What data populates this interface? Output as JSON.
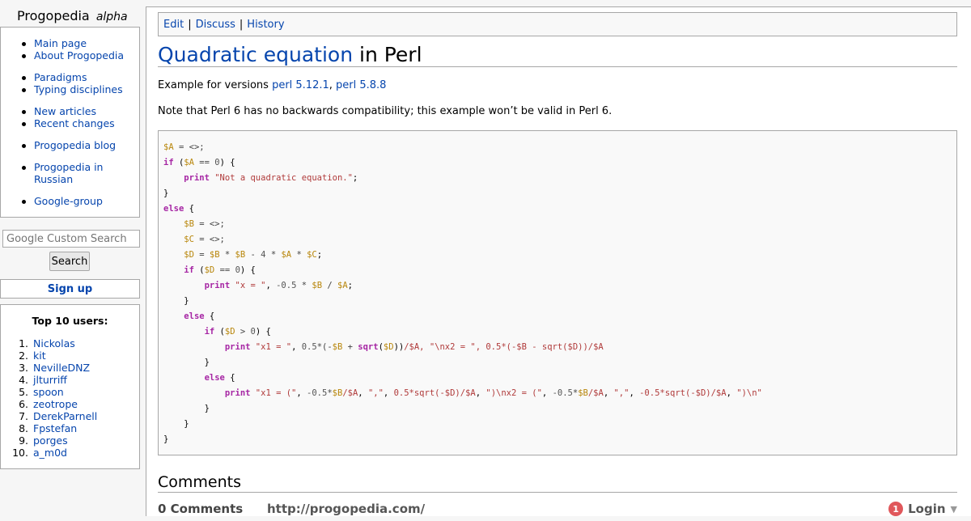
{
  "site": {
    "name": "Progopedia",
    "tag": "alpha"
  },
  "nav": {
    "groups": [
      [
        "Main page",
        "About Progopedia"
      ],
      [
        "Paradigms",
        "Typing disciplines"
      ],
      [
        "New articles",
        "Recent changes"
      ],
      [
        "Progopedia blog"
      ],
      [
        "Progopedia in Russian"
      ],
      [
        "Google-group"
      ]
    ]
  },
  "search": {
    "placeholder": "Google Custom Search",
    "button": "Search"
  },
  "signup": "Sign up",
  "top_users": {
    "title": "Top 10 users:",
    "users": [
      "Nickolas",
      "kit",
      "NevilleDNZ",
      "jlturriff",
      "spoon",
      "zeotrope",
      "DerekParnell",
      "Fpstefan",
      "porges",
      "a_m0d"
    ]
  },
  "actions": {
    "edit": "Edit",
    "discuss": "Discuss",
    "history": "History",
    "sep": "|"
  },
  "page": {
    "title_link": "Quadratic equation",
    "title_rest": " in Perl",
    "versions_prefix": "Example for versions ",
    "versions": [
      "perl 5.12.1",
      "perl 5.8.8"
    ],
    "versions_sep": ", ",
    "note": "Note that Perl 6 has no backwards compatibility; this example won’t be valid in Perl 6."
  },
  "code": [
    [
      [
        "v",
        "$A"
      ],
      [
        "o",
        " = <>;"
      ]
    ],
    [
      [
        "k",
        "if"
      ],
      [
        "p",
        " ("
      ],
      [
        "v",
        "$A"
      ],
      [
        "o",
        " == "
      ],
      [
        "n",
        "0"
      ],
      [
        "p",
        ") {"
      ]
    ],
    [
      [
        "p",
        "    "
      ],
      [
        "k",
        "print"
      ],
      [
        "p",
        " "
      ],
      [
        "s",
        "\"Not a quadratic equation.\""
      ],
      [
        "p",
        ";"
      ]
    ],
    [
      [
        "p",
        "}"
      ]
    ],
    [
      [
        "k",
        "else"
      ],
      [
        "p",
        " {"
      ]
    ],
    [
      [
        "p",
        "    "
      ],
      [
        "v",
        "$B"
      ],
      [
        "o",
        " = <>;"
      ]
    ],
    [
      [
        "p",
        "    "
      ],
      [
        "v",
        "$C"
      ],
      [
        "o",
        " = <>;"
      ]
    ],
    [
      [
        "p",
        "    "
      ],
      [
        "v",
        "$D"
      ],
      [
        "o",
        " = "
      ],
      [
        "v",
        "$B"
      ],
      [
        "o",
        " * "
      ],
      [
        "v",
        "$B"
      ],
      [
        "o",
        " - "
      ],
      [
        "n",
        "4"
      ],
      [
        "o",
        " * "
      ],
      [
        "v",
        "$A"
      ],
      [
        "o",
        " * "
      ],
      [
        "v",
        "$C"
      ],
      [
        "p",
        ";"
      ]
    ],
    [
      [
        "p",
        "    "
      ],
      [
        "k",
        "if"
      ],
      [
        "p",
        " ("
      ],
      [
        "v",
        "$D"
      ],
      [
        "o",
        " == "
      ],
      [
        "n",
        "0"
      ],
      [
        "p",
        ") {"
      ]
    ],
    [
      [
        "p",
        "        "
      ],
      [
        "k",
        "print"
      ],
      [
        "p",
        " "
      ],
      [
        "s",
        "\"x = \""
      ],
      [
        "p",
        ", "
      ],
      [
        "n",
        "-0.5"
      ],
      [
        "o",
        " * "
      ],
      [
        "v",
        "$B"
      ],
      [
        "o",
        " / "
      ],
      [
        "v",
        "$A"
      ],
      [
        "p",
        ";"
      ]
    ],
    [
      [
        "p",
        "    }"
      ]
    ],
    [
      [
        "p",
        "    "
      ],
      [
        "k",
        "else"
      ],
      [
        "p",
        " {"
      ]
    ],
    [
      [
        "p",
        "        "
      ],
      [
        "k",
        "if"
      ],
      [
        "p",
        " ("
      ],
      [
        "v",
        "$D"
      ],
      [
        "o",
        " > "
      ],
      [
        "n",
        "0"
      ],
      [
        "p",
        ") {"
      ]
    ],
    [
      [
        "p",
        "            "
      ],
      [
        "k",
        "print"
      ],
      [
        "p",
        " "
      ],
      [
        "s",
        "\"x1 = \""
      ],
      [
        "p",
        ", "
      ],
      [
        "n",
        "0.5"
      ],
      [
        "o",
        "*(-"
      ],
      [
        "v",
        "$B"
      ],
      [
        "o",
        " + "
      ],
      [
        "k",
        "sqrt"
      ],
      [
        "p",
        "("
      ],
      [
        "v",
        "$D"
      ],
      [
        "p",
        "))"
      ],
      [
        "s",
        "/$A, \"\\nx2 = \", 0.5*(-$B - sqrt($D))/$A"
      ]
    ],
    [
      [
        "p",
        "        }"
      ]
    ],
    [
      [
        "p",
        "        "
      ],
      [
        "k",
        "else"
      ],
      [
        "p",
        " {"
      ]
    ],
    [
      [
        "p",
        "            "
      ],
      [
        "k",
        "print"
      ],
      [
        "p",
        " "
      ],
      [
        "s",
        "\"x1 = (\""
      ],
      [
        "p",
        ", "
      ],
      [
        "n",
        "-0.5"
      ],
      [
        "o",
        "*"
      ],
      [
        "v",
        "$B"
      ],
      [
        "s",
        "/$A"
      ],
      [
        "p",
        ", "
      ],
      [
        "s",
        "\",\""
      ],
      [
        "p",
        ", "
      ],
      [
        "s",
        "0.5*sqrt(-$D)/$A"
      ],
      [
        "p",
        ", "
      ],
      [
        "s",
        "\")\\nx2 = (\""
      ],
      [
        "p",
        ", "
      ],
      [
        "n",
        "-0.5"
      ],
      [
        "o",
        "*"
      ],
      [
        "v",
        "$B"
      ],
      [
        "s",
        "/$A"
      ],
      [
        "p",
        ", "
      ],
      [
        "s",
        "\",\""
      ],
      [
        "p",
        ", "
      ],
      [
        "s",
        "-0.5*sqrt(-$D)/$A"
      ],
      [
        "p",
        ", "
      ],
      [
        "s",
        "\")\\n\""
      ]
    ],
    [
      [
        "p",
        "        }"
      ]
    ],
    [
      [
        "p",
        "    }"
      ]
    ],
    [
      [
        "p",
        "}"
      ]
    ]
  ],
  "code_colors": {
    "k": "#a626a4",
    "v": "#b8860b",
    "s": "#b03a3a",
    "n": "#555555",
    "o": "#444444",
    "p": "#000000"
  },
  "comments": {
    "title": "Comments",
    "count": "0 Comments",
    "url": "http://progopedia.com/",
    "login_badge": "1",
    "login": "Login"
  }
}
